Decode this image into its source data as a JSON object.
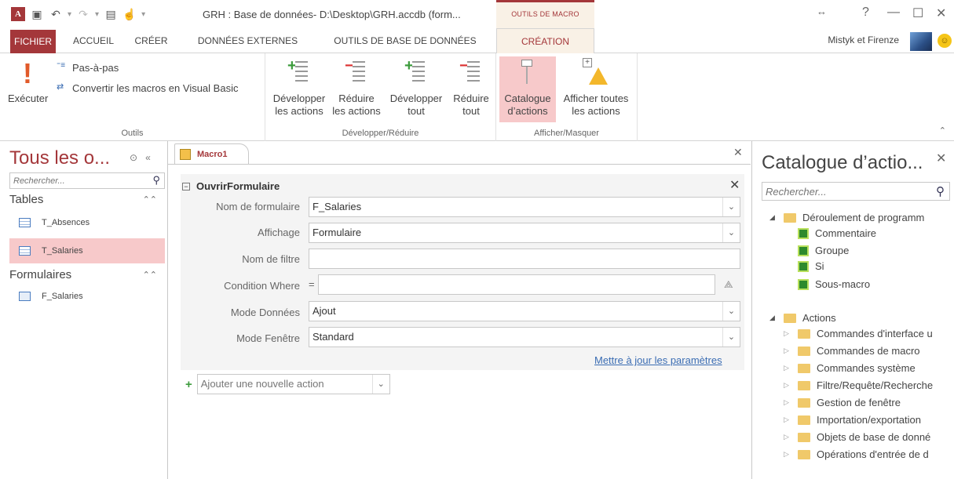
{
  "titlebar": {
    "window_title": "GRH : Base de données- D:\\Desktop\\GRH.accdb (form...",
    "context_tab_group": "OUTILS DE MACRO",
    "help": "?",
    "minimize": "—",
    "restore": "☐",
    "close": "✕",
    "ribbon_options": "↔"
  },
  "tabs": {
    "file": "FICHIER",
    "home": "ACCUEIL",
    "create": "CRÉER",
    "external": "DONNÉES EXTERNES",
    "dbtools": "OUTILS DE BASE DE DONNÉES",
    "design": "CRÉATION"
  },
  "account": {
    "name": "Mistyk et Firenze"
  },
  "ribbon": {
    "tools": {
      "run": "Exécuter",
      "single_step": "Pas-à-pas",
      "convert": "Convertir les macros en Visual Basic",
      "label": "Outils"
    },
    "expand_collapse": {
      "expand_actions": [
        "Développer",
        "les actions"
      ],
      "collapse_actions": [
        "Réduire",
        "les actions"
      ],
      "expand_all": [
        "Développer",
        "tout"
      ],
      "collapse_all": [
        "Réduire",
        "tout"
      ],
      "label": "Développer/Réduire"
    },
    "show_hide": {
      "catalog": [
        "Catalogue",
        "d’actions"
      ],
      "show_all": [
        "Afficher toutes",
        "les actions"
      ],
      "label": "Afficher/Masquer"
    }
  },
  "nav": {
    "title": "Tous les o...",
    "search_placeholder": "Rechercher...",
    "sections": [
      {
        "label": "Tables",
        "items": [
          "T_Absences",
          "T_Salaries"
        ]
      },
      {
        "label": "Formulaires",
        "items": [
          "F_Salaries"
        ]
      }
    ]
  },
  "document": {
    "tab_label": "Macro1",
    "action": {
      "name": "OuvrirFormulaire",
      "arguments": [
        {
          "label": "Nom de formulaire",
          "value": "F_Salaries"
        },
        {
          "label": "Affichage",
          "value": "Formulaire"
        },
        {
          "label": "Nom de filtre",
          "value": ""
        },
        {
          "label": "Condition Where",
          "value": "="
        },
        {
          "label": "Mode Données",
          "value": "Ajout"
        },
        {
          "label": "Mode Fenêtre",
          "value": "Standard"
        }
      ],
      "update_link": "Mettre à jour les paramètres"
    },
    "add_action_placeholder": "Ajouter une nouvelle action"
  },
  "catalog": {
    "title": "Catalogue d’actio...",
    "search_placeholder": "Rechercher...",
    "program_flow": {
      "label": "Déroulement de programm",
      "items": [
        "Commentaire",
        "Groupe",
        "Si",
        "Sous-macro"
      ]
    },
    "actions": {
      "label": "Actions",
      "items": [
        "Commandes d'interface u",
        "Commandes de macro",
        "Commandes système",
        "Filtre/Requête/Recherche",
        "Gestion de fenêtre",
        "Importation/exportation",
        "Objets de base de donné",
        "Opérations d'entrée de d"
      ]
    }
  },
  "colors": {
    "accent": "#a4373a",
    "selection": "#f7c9ca",
    "link": "#3b6db3"
  }
}
